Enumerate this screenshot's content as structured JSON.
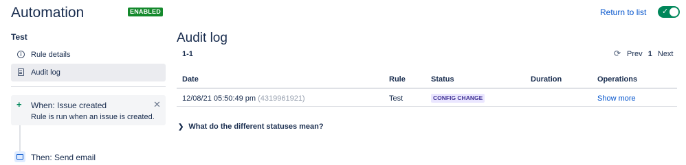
{
  "header": {
    "title": "Automation",
    "status_badge": "ENABLED",
    "return_link": "Return to list",
    "toggle_on": true,
    "accent_color": "#00875a"
  },
  "sidebar": {
    "rule_name": "Test",
    "items": [
      {
        "label": "Rule details",
        "icon": "info-icon"
      },
      {
        "label": "Audit log",
        "icon": "document-icon",
        "selected": true
      }
    ],
    "trigger": {
      "title": "When: Issue created",
      "description": "Rule is run when an issue is created.",
      "icon": "plus-icon"
    },
    "action": {
      "title": "Then: Send email",
      "icon": "mail-icon"
    }
  },
  "main": {
    "title": "Audit log",
    "range": "1-1",
    "pager": {
      "prev": "Prev",
      "current": "1",
      "next": "Next"
    },
    "table": {
      "columns": [
        "Date",
        "Rule",
        "Status",
        "Duration",
        "Operations"
      ],
      "rows": [
        {
          "date": "12/08/21 05:50:49 pm",
          "id": "(4319961921)",
          "rule": "Test",
          "status": "CONFIG CHANGE",
          "duration": "",
          "operations": "Show more"
        }
      ]
    },
    "faq": "What do the different statuses mean?"
  }
}
